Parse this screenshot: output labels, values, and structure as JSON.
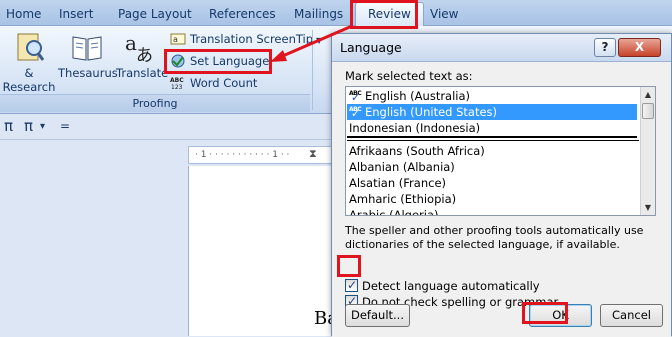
{
  "ribbon": {
    "tabs": [
      "Home",
      "Insert",
      "Page Layout",
      "References",
      "Mailings",
      "Review",
      "View"
    ],
    "active_tab": "Review",
    "buttons": {
      "research": "& Research",
      "thesaurus": "Thesaurus",
      "translate": "Translate",
      "translation_screentip": "Translation ScreenTip",
      "set_language": "Set Language",
      "word_count": "Word Count"
    },
    "group_label": "Proofing",
    "highlight_color": "#e0141e"
  },
  "document": {
    "qat_symbols": [
      "π",
      "π",
      "▾",
      "="
    ],
    "ruler_text": "· 1 · · · · · · · · · · · 1 · ·",
    "page_text": "Ba"
  },
  "dialog": {
    "title": "Language",
    "help_button": "?",
    "close_button": "X",
    "list_label": "Mark selected text as:",
    "languages": [
      "English (Australia)",
      "English (United States)",
      "Indonesian (Indonesia)",
      "Afrikaans (South Africa)",
      "Albanian (Albania)",
      "Alsatian (France)",
      "Amharic (Ethiopia)",
      "Arabic (Algeria)"
    ],
    "selected_language": "English (United States)",
    "description": "The speller and other proofing tools automatically use dictionaries of the selected language, if available.",
    "checkboxes": {
      "do_not_check": {
        "label": "Do not check spelling or grammar",
        "checked": true
      },
      "detect_language": {
        "label": "Detect language automatically",
        "checked": true
      }
    },
    "buttons": {
      "default": "Default...",
      "ok": "OK",
      "cancel": "Cancel"
    },
    "selection_color": "#3399ff"
  }
}
